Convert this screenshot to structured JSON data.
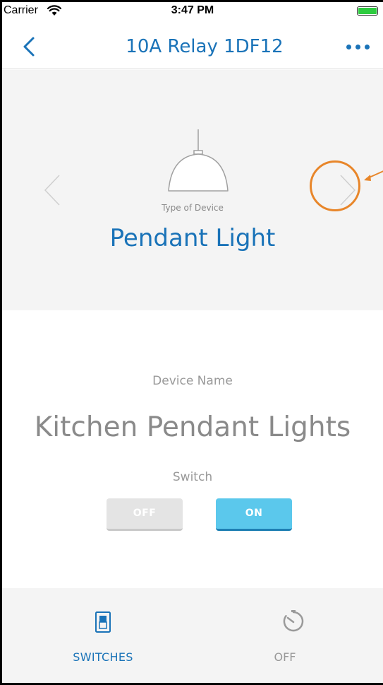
{
  "status_bar": {
    "carrier": "Carrier",
    "time": "3:47 PM"
  },
  "nav": {
    "title": "10A Relay 1DF12",
    "back_icon": "chevron-left-icon",
    "more_icon": "more-dots-icon"
  },
  "device_type": {
    "label": "Type of Device",
    "value": "Pendant Light",
    "icon": "pendant-light-icon"
  },
  "device": {
    "name_label": "Device Name",
    "name_value": "Kitchen Pendant Lights",
    "switch_label": "Switch",
    "off_label": "OFF",
    "on_label": "ON",
    "switch_state": "ON"
  },
  "tabs": [
    {
      "label": "SWITCHES",
      "icon": "switch-icon",
      "active": true
    },
    {
      "label": "OFF",
      "icon": "timer-icon",
      "active": false
    }
  ],
  "colors": {
    "accent": "#1a73b8",
    "on_button": "#5bc8ec",
    "highlight": "#e8862a",
    "battery": "#2ecc40"
  }
}
